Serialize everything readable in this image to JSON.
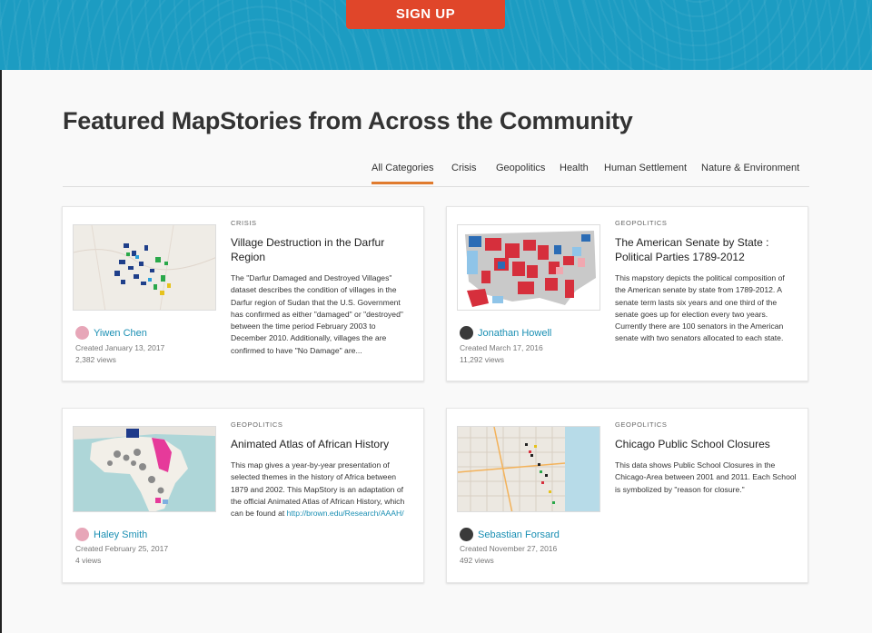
{
  "hero": {
    "signup_label": "SIGN UP"
  },
  "section": {
    "title": "Featured MapStories from Across the Community"
  },
  "tabs": [
    {
      "label": "All Categories",
      "active": true
    },
    {
      "label": "Crisis"
    },
    {
      "label": "Geopolitics"
    },
    {
      "label": "Health"
    },
    {
      "label": "Human Settlement"
    },
    {
      "label": "Nature & Environment"
    }
  ],
  "cards": [
    {
      "category": "CRISIS",
      "title": "Village Destruction in the Darfur Region",
      "description": "The \"Darfur Damaged and Destroyed Villages\" dataset describes the condition of villages in the Darfur region of Sudan that the U.S. Government has confirmed as either \"damaged\" or \"destroyed\" between the time period February 2003 to December 2010. Additionally, villages the are confirmed to have \"No Damage\" are...",
      "author": "Yiwen Chen",
      "created": "Created January 13, 2017",
      "views": "2,382 views"
    },
    {
      "category": "GEOPOLITICS",
      "title": "The American Senate by State : Political Parties 1789-2012",
      "description": "This mapstory depicts the political composition of the American senate by state from 1789-2012. A senate term lasts six years and one third of the senate goes up for election every two years. Currently there are 100 senators in the American senate with two senators allocated to each state.",
      "author": "Jonathan Howell",
      "created": "Created March 17, 2016",
      "views": "11,292 views"
    },
    {
      "category": "GEOPOLITICS",
      "title": "Animated Atlas of African History",
      "description": "This map gives a year-by-year presentation of selected themes in the history of Africa between 1879 and 2002. This MapStory is an adaptation of the official Animated Atlas of African History, which can be found at",
      "link": "http://brown.edu/Research/AAAH/",
      "author": "Haley Smith",
      "created": "Created February 25, 2017",
      "views": "4 views"
    },
    {
      "category": "GEOPOLITICS",
      "title": "Chicago Public School Closures",
      "description": "This data shows Public School Closures in the Chicago-Area between 2001 and 2011. Each School is symbolized by \"reason for closure.\"",
      "author": "Sebastian Forsard",
      "created": "Created November 27, 2016",
      "views": "492 views"
    }
  ],
  "colors": {
    "accent": "#e0462a",
    "hero": "#1c9cc2",
    "link": "#1a8fb3",
    "tab_underline": "#e07b2e"
  }
}
